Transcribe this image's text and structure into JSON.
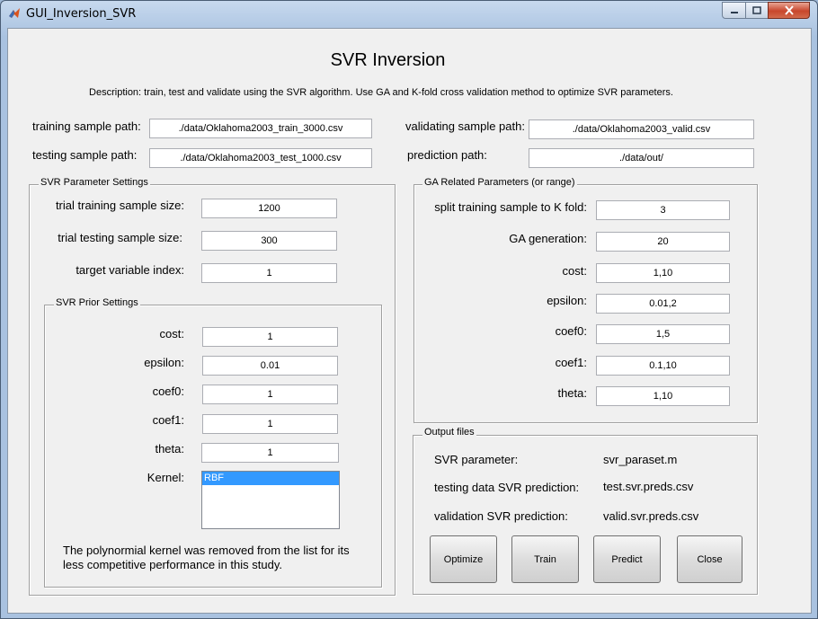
{
  "window": {
    "title": "GUI_Inversion_SVR"
  },
  "header": {
    "title": "SVR Inversion",
    "description": "Description: train, test and validate using the SVR algorithm. Use GA and K-fold cross validation method to optimize SVR parameters."
  },
  "paths": {
    "training_label": "training sample path:",
    "training_value": "./data/Oklahoma2003_train_3000.csv",
    "testing_label": "testing sample path:",
    "testing_value": "./data/Oklahoma2003_test_1000.csv",
    "validating_label": "validating sample path:",
    "validating_value": "./data/Oklahoma2003_valid.csv",
    "prediction_label": "prediction path:",
    "prediction_value": "./data/out/"
  },
  "svr_params": {
    "title": "SVR Parameter Settings",
    "trial_train_label": "trial training sample size:",
    "trial_train_value": "1200",
    "trial_test_label": "trial testing sample size:",
    "trial_test_value": "300",
    "target_label": "target variable index:",
    "target_value": "1"
  },
  "svr_prior": {
    "title": "SVR Prior Settings",
    "cost_label": "cost:",
    "cost_value": "1",
    "epsilon_label": "epsilon:",
    "epsilon_value": "0.01",
    "coef0_label": "coef0:",
    "coef0_value": "1",
    "coef1_label": "coef1:",
    "coef1_value": "1",
    "theta_label": "theta:",
    "theta_value": "1",
    "kernel_label": "Kernel:",
    "kernel_options": [
      "RBF"
    ],
    "note": "The polynormial kernel was removed from the list for its less competitive performance in this study."
  },
  "ga": {
    "title": "GA Related Parameters (or range)",
    "kfold_label": "split training sample to K fold:",
    "kfold_value": "3",
    "generation_label": "GA generation:",
    "generation_value": "20",
    "cost_label": "cost:",
    "cost_value": "1,10",
    "epsilon_label": "epsilon:",
    "epsilon_value": "0.01,2",
    "coef0_label": "coef0:",
    "coef0_value": "1,5",
    "coef1_label": "coef1:",
    "coef1_value": "0.1,10",
    "theta_label": "theta:",
    "theta_value": "1,10"
  },
  "output": {
    "title": "Output files",
    "param_label": "SVR parameter:",
    "param_value": "svr_paraset.m",
    "test_label": "testing data SVR prediction:",
    "test_value": "test.svr.preds.csv",
    "valid_label": "validation SVR prediction:",
    "valid_value": "valid.svr.preds.csv"
  },
  "buttons": {
    "optimize": "Optimize",
    "train": "Train",
    "predict": "Predict",
    "close": "Close"
  },
  "colors": {
    "selection": "#3399ff",
    "client_bg": "#f0f0f0"
  }
}
